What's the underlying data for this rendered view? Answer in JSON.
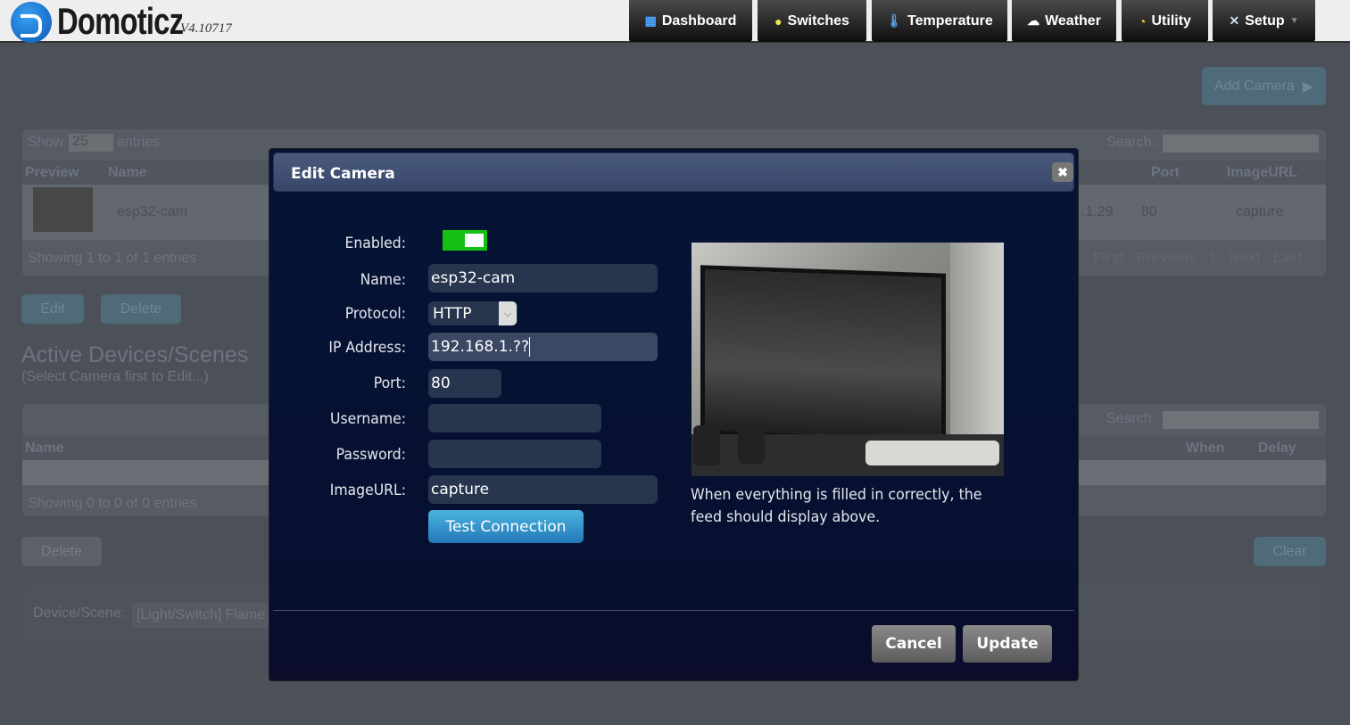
{
  "header": {
    "logo": "Domoticz",
    "version": "V4.10717",
    "nav": [
      {
        "label": "Dashboard",
        "icon": "dashboard-icon"
      },
      {
        "label": "Switches",
        "icon": "bulb-icon"
      },
      {
        "label": "Temperature",
        "icon": "thermometer-icon"
      },
      {
        "label": "Weather",
        "icon": "cloud-rain-icon"
      },
      {
        "label": "Utility",
        "icon": "gauge-icon"
      },
      {
        "label": "Setup",
        "icon": "tools-icon"
      }
    ]
  },
  "background": {
    "add_camera": "Add Camera",
    "show": "Show",
    "entries_value": "25",
    "entries": "entries",
    "search": "Search :",
    "columns": [
      "Preview",
      "Name",
      "Port",
      "ImageURL"
    ],
    "row": {
      "name": "esp32-cam",
      "ip_fragment": ".1.29",
      "port": "80",
      "imageurl": "capture"
    },
    "info": "Showing 1 to 1 of 1 entries",
    "pager": [
      "First",
      "Previous",
      "1",
      "Next",
      "Last"
    ],
    "edit": "Edit",
    "delete": "Delete",
    "section_title": "Active Devices/Scenes",
    "section_sub": "(Select Camera first to Edit...)",
    "columns2": [
      "Name",
      "When",
      "Delay"
    ],
    "info2": "Showing 0 to 0 of 0 entries",
    "delete2": "Delete",
    "clear": "Clear",
    "device_label": "Device/Scene:",
    "device_value": "[Light/Switch] Flame"
  },
  "dialog": {
    "title": "Edit Camera",
    "labels": {
      "enabled": "Enabled:",
      "name": "Name:",
      "protocol": "Protocol:",
      "ip": "IP Address:",
      "port": "Port:",
      "username": "Username:",
      "password": "Password:",
      "imageurl": "ImageURL:"
    },
    "values": {
      "enabled": true,
      "name": "esp32-cam",
      "protocol": "HTTP",
      "ip": "192.168.1.??",
      "port": "80",
      "username": "",
      "password": "",
      "imageurl": "capture"
    },
    "test_connection": "Test Connection",
    "caption": "When everything is filled in correctly, the feed should display above.",
    "cancel": "Cancel",
    "update": "Update",
    "toggle_color": "#14c014"
  }
}
